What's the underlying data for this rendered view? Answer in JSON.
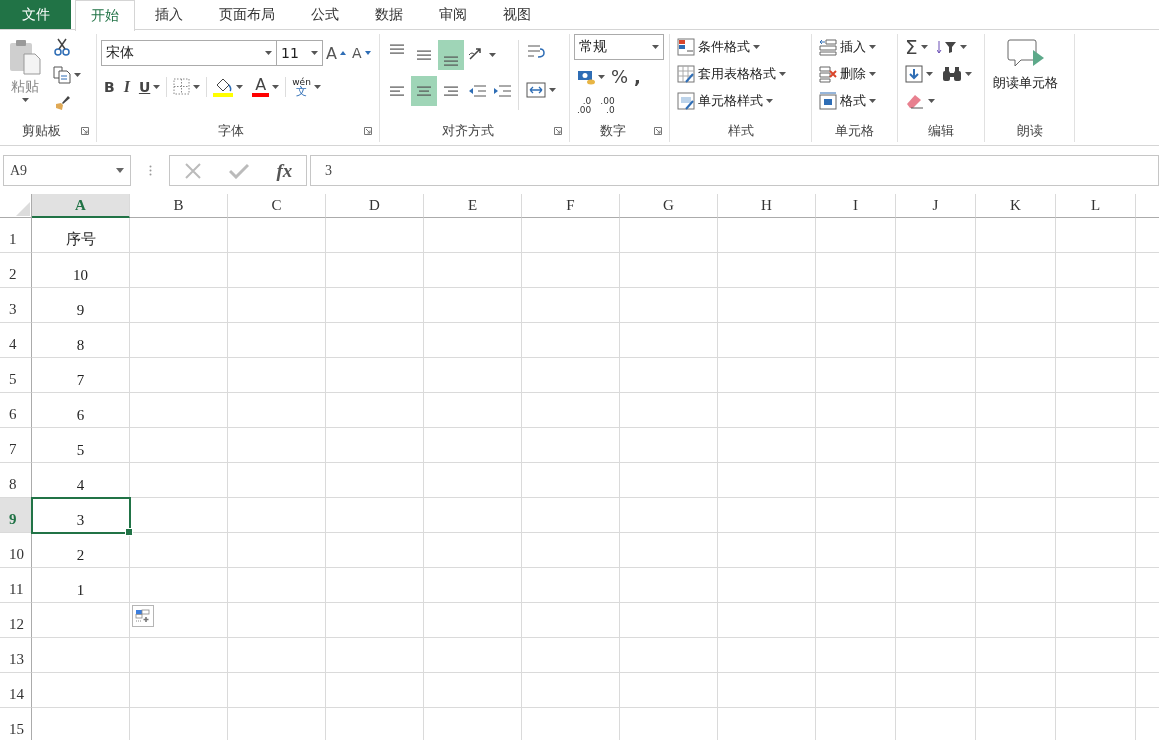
{
  "tabs": [
    {
      "label": "文件",
      "kind": "file",
      "selected": false
    },
    {
      "label": "开始",
      "kind": "tab",
      "selected": true
    },
    {
      "label": "插入",
      "kind": "tab",
      "selected": false
    },
    {
      "label": "页面布局",
      "kind": "tab",
      "selected": false
    },
    {
      "label": "公式",
      "kind": "tab",
      "selected": false
    },
    {
      "label": "数据",
      "kind": "tab",
      "selected": false
    },
    {
      "label": "审阅",
      "kind": "tab",
      "selected": false
    },
    {
      "label": "视图",
      "kind": "tab",
      "selected": false
    }
  ],
  "ribbon": {
    "clipboard": {
      "label": "剪贴板",
      "paste": "粘贴"
    },
    "font": {
      "label": "字体",
      "font_name": "宋体",
      "font_size": "11",
      "grow_font": "A",
      "shrink_font": "A",
      "bold": "B",
      "italic": "I",
      "underline": "U",
      "font_color": "A",
      "phonetic": [
        "wén",
        "文"
      ]
    },
    "alignment": {
      "label": "对齐方式",
      "vertical": [
        {
          "selected": false
        },
        {
          "selected": false
        },
        {
          "selected": true
        }
      ],
      "horizontal": [
        {
          "selected": false
        },
        {
          "selected": true
        },
        {
          "selected": false
        }
      ]
    },
    "number": {
      "label": "数字",
      "format": "常规",
      "percent": "%",
      "comma": ",",
      "increase_decimal": [
        ".0",
        ".00"
      ],
      "decrease_decimal": [
        ".00",
        ".0"
      ]
    },
    "styles": {
      "label": "样式",
      "items": [
        "条件格式",
        "套用表格格式",
        "单元格样式"
      ]
    },
    "cells": {
      "label": "单元格",
      "items": [
        "插入",
        "删除",
        "格式"
      ]
    },
    "editing": {
      "label": "编辑",
      "sum": "Σ"
    },
    "read": {
      "label": "朗读",
      "button": "朗读单元格"
    }
  },
  "formula_bar": {
    "name_box": "A9",
    "function": "fx",
    "value": "3"
  },
  "sheet": {
    "columns": [
      {
        "label": "A",
        "selected": true
      },
      {
        "label": "B",
        "selected": false
      },
      {
        "label": "C",
        "selected": false
      },
      {
        "label": "D",
        "selected": false
      },
      {
        "label": "E",
        "selected": false
      },
      {
        "label": "F",
        "selected": false
      },
      {
        "label": "G",
        "selected": false
      },
      {
        "label": "H",
        "selected": false
      },
      {
        "label": "I",
        "selected": false
      },
      {
        "label": "J",
        "selected": false
      },
      {
        "label": "K",
        "selected": false
      },
      {
        "label": "L",
        "selected": false
      }
    ],
    "rows": [
      {
        "header": "1",
        "selected": false,
        "cells": [
          {
            "value": "序号",
            "active": false
          }
        ]
      },
      {
        "header": "2",
        "selected": false,
        "cells": [
          {
            "value": "10",
            "active": false
          }
        ]
      },
      {
        "header": "3",
        "selected": false,
        "cells": [
          {
            "value": "9",
            "active": false
          }
        ]
      },
      {
        "header": "4",
        "selected": false,
        "cells": [
          {
            "value": "8",
            "active": false
          }
        ]
      },
      {
        "header": "5",
        "selected": false,
        "cells": [
          {
            "value": "7",
            "active": false
          }
        ]
      },
      {
        "header": "6",
        "selected": false,
        "cells": [
          {
            "value": "6",
            "active": false
          }
        ]
      },
      {
        "header": "7",
        "selected": false,
        "cells": [
          {
            "value": "5",
            "active": false
          }
        ]
      },
      {
        "header": "8",
        "selected": false,
        "cells": [
          {
            "value": "4",
            "active": false
          }
        ]
      },
      {
        "header": "9",
        "selected": true,
        "cells": [
          {
            "value": "3",
            "active": true
          }
        ]
      },
      {
        "header": "10",
        "selected": false,
        "cells": [
          {
            "value": "2",
            "active": false
          }
        ]
      },
      {
        "header": "11",
        "selected": false,
        "cells": [
          {
            "value": "1",
            "active": false
          }
        ]
      },
      {
        "header": "12",
        "selected": false
      },
      {
        "header": "13",
        "selected": false
      },
      {
        "header": "14",
        "selected": false
      },
      {
        "header": "15",
        "selected": false
      }
    ]
  }
}
